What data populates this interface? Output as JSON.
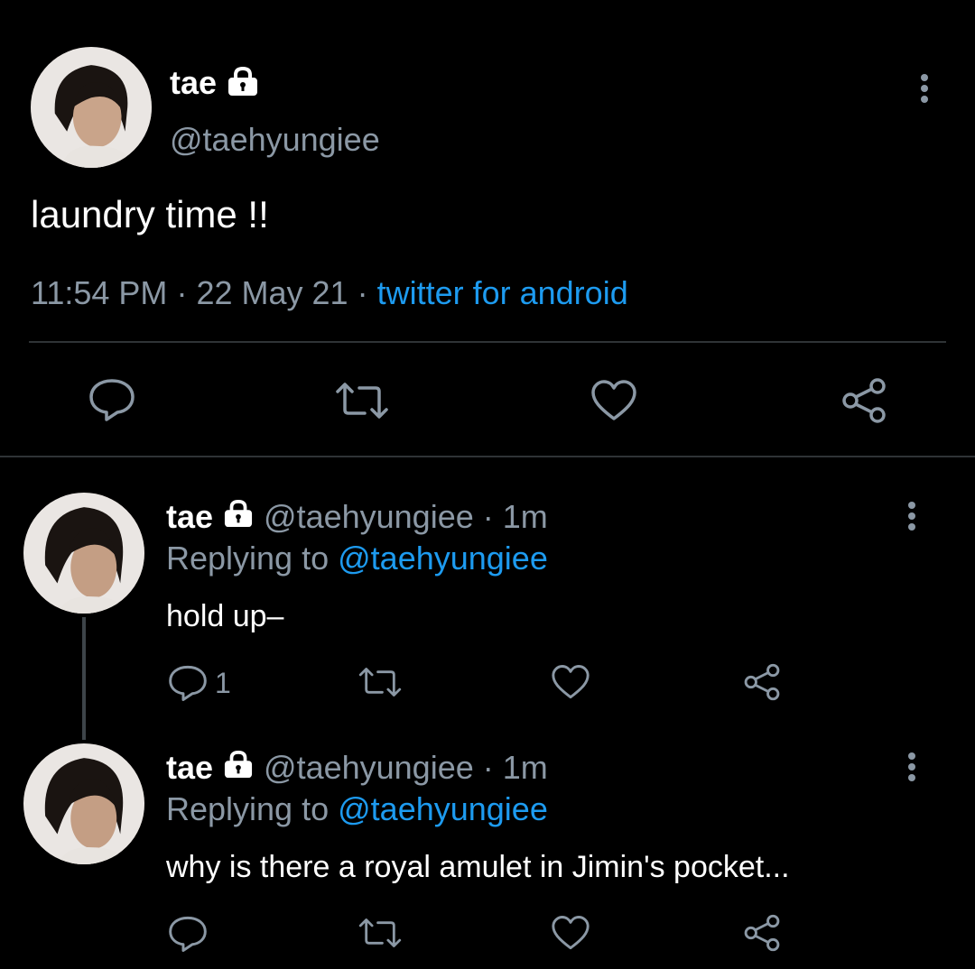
{
  "main_tweet": {
    "display_name": "tae",
    "handle": "@taehyungiee",
    "text": "laundry time !!",
    "time": "11:54 PM",
    "sep1": "·",
    "date": "22 May 21",
    "sep2": "·",
    "source": "twitter for android"
  },
  "replies": [
    {
      "display_name": "tae",
      "handle": "@taehyungiee",
      "dot": "·",
      "age": "1m",
      "replying_label": "Replying to",
      "replying_handle": "@taehyungiee",
      "text": "hold up–",
      "reply_count": "1"
    },
    {
      "display_name": "tae",
      "handle": "@taehyungiee",
      "dot": "·",
      "age": "1m",
      "replying_label": "Replying to",
      "replying_handle": "@taehyungiee",
      "text": "why is there a royal amulet in Jimin's pocket..."
    }
  ],
  "icons": {
    "reply": "reply-icon",
    "retweet": "retweet-icon",
    "like": "heart-icon",
    "share": "share-icon",
    "more": "more-icon",
    "lock": "lock-icon"
  },
  "colors": {
    "background": "#000000",
    "muted": "#8b98a5",
    "link": "#1d9bf0",
    "text": "#ffffff"
  }
}
